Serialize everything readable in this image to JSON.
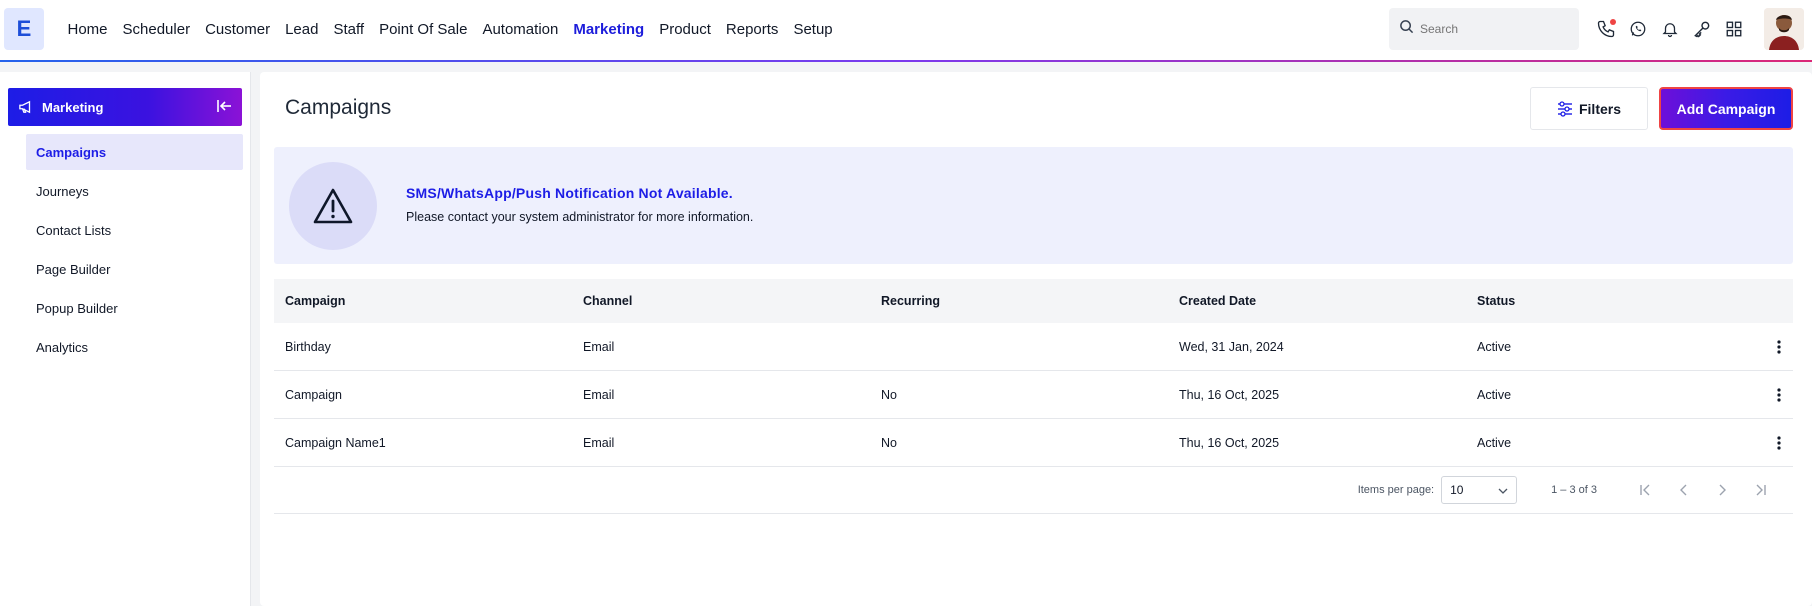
{
  "app": {
    "logo_letter": "E"
  },
  "nav": {
    "items": [
      "Home",
      "Scheduler",
      "Customer",
      "Lead",
      "Staff",
      "Point Of Sale",
      "Automation",
      "Marketing",
      "Product",
      "Reports",
      "Setup"
    ],
    "active": "Marketing"
  },
  "search": {
    "placeholder": "Search",
    "value": ""
  },
  "top_icons": [
    "phone-icon",
    "whatsapp-icon",
    "bell-icon",
    "key-icon",
    "grid-icon"
  ],
  "sidebar": {
    "title": "Marketing",
    "items": [
      {
        "label": "Campaigns",
        "active": true
      },
      {
        "label": "Journeys",
        "active": false
      },
      {
        "label": "Contact Lists",
        "active": false
      },
      {
        "label": "Page Builder",
        "active": false
      },
      {
        "label": "Popup Builder",
        "active": false
      },
      {
        "label": "Analytics",
        "active": false
      }
    ]
  },
  "main": {
    "title": "Campaigns",
    "filters_label": "Filters",
    "add_label": "Add Campaign",
    "alert": {
      "title": "SMS/WhatsApp/Push Notification Not Available.",
      "text": "Please contact your system administrator for more information."
    },
    "table": {
      "columns": [
        "Campaign",
        "Channel",
        "Recurring",
        "Created Date",
        "Status"
      ],
      "rows": [
        [
          "Birthday",
          "Email",
          "",
          "Wed, 31 Jan, 2024",
          "Active"
        ],
        [
          "Campaign",
          "Email",
          "No",
          "Thu, 16 Oct, 2025",
          "Active"
        ],
        [
          "Campaign Name1",
          "Email",
          "No",
          "Thu, 16 Oct, 2025",
          "Active"
        ]
      ]
    },
    "pager": {
      "items_per_page_label": "Items per page:",
      "items_per_page": "10",
      "range": "1 – 3 of 3"
    }
  },
  "colors": {
    "accent": "#1d1de6",
    "alert_bg": "#eef0fd",
    "danger": "#ef4444"
  }
}
